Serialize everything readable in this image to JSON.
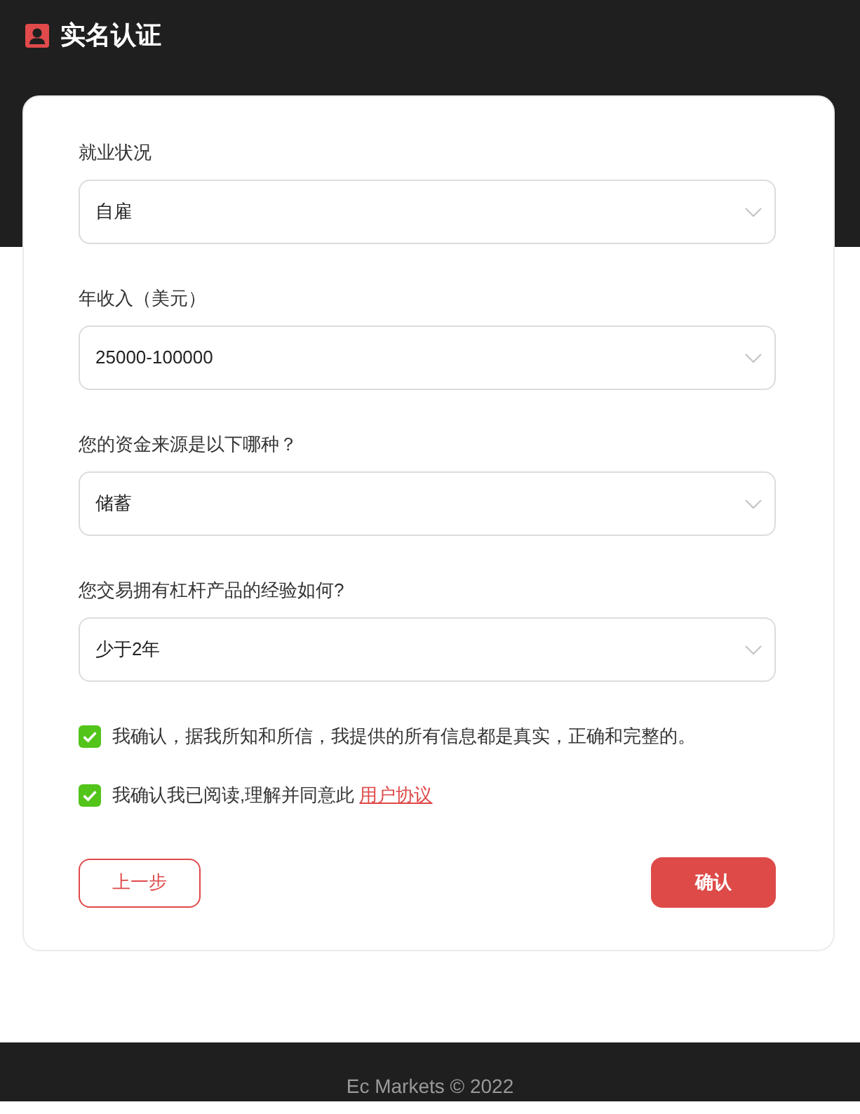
{
  "header": {
    "title": "实名认证"
  },
  "fields": [
    {
      "label": "就业状况",
      "value": "自雇"
    },
    {
      "label": "年收入（美元）",
      "value": "25000-100000"
    },
    {
      "label": "您的资金来源是以下哪种？",
      "value": "储蓄"
    },
    {
      "label": "您交易拥有杠杆产品的经验如何?",
      "value": "少于2年"
    }
  ],
  "agreements": [
    {
      "text": "我确认，据我所知和所信，我提供的所有信息都是真实，正确和完整的。",
      "checked": true
    },
    {
      "text": "我确认我已阅读,理解并同意此 ",
      "link": "用户协议",
      "checked": true
    }
  ],
  "buttons": [
    {
      "label": "上一步",
      "kind": "secondary"
    },
    {
      "label": "确认",
      "kind": "primary"
    }
  ],
  "footer": {
    "text": "Ec Markets © 2022"
  }
}
